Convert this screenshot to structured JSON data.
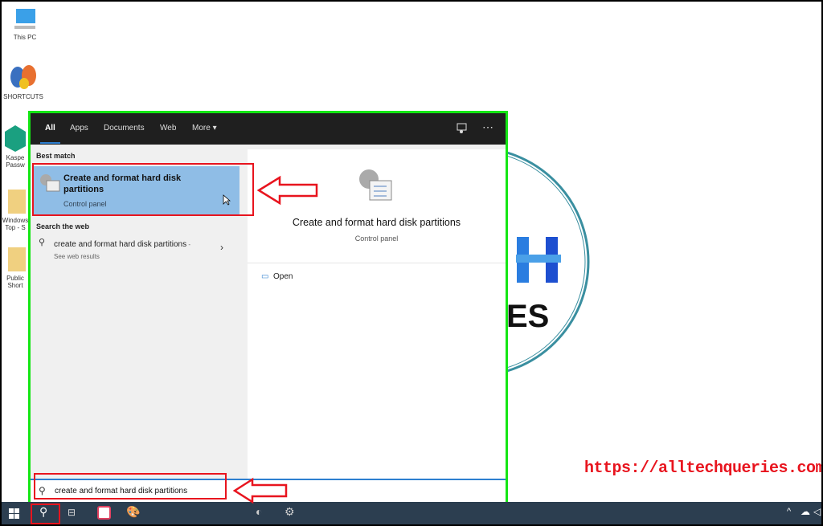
{
  "desktop": {
    "icons": [
      {
        "label": "This PC",
        "icon": "computer-icon"
      },
      {
        "label": "SHORTCUTS",
        "icon": "butterfly-icon"
      },
      {
        "label": "Kaspe Passw",
        "icon": "kaspersky-icon"
      },
      {
        "label": "Windows Top - S",
        "icon": "folder-shortcut-icon"
      },
      {
        "label": "Public Short",
        "icon": "folder-shortcut-icon"
      }
    ],
    "watermark_url": "https://alltechqueries.com/",
    "logo_text": "TECH QUERIES"
  },
  "search_panel": {
    "tabs": [
      {
        "label": "All",
        "active": true
      },
      {
        "label": "Apps"
      },
      {
        "label": "Documents"
      },
      {
        "label": "Web"
      },
      {
        "label": "More"
      }
    ],
    "best_match_header": "Best match",
    "best_match": {
      "title": "Create and format hard disk partitions",
      "subtitle": "Control panel"
    },
    "web_header": "Search the web",
    "web_result": {
      "query": "create and format hard disk partitions",
      "suffix": " - See web results"
    },
    "preview": {
      "title": "Create and format hard disk partitions",
      "subtitle": "Control panel",
      "actions": [
        {
          "label": "Open"
        }
      ]
    },
    "query": "create and format hard disk partitions"
  },
  "colors": {
    "accent": "#2d7fd0",
    "highlight": "#8fbde6",
    "annotation_red": "#e8141e",
    "annotation_green": "#14e614",
    "taskbar": "#2c3e50"
  }
}
